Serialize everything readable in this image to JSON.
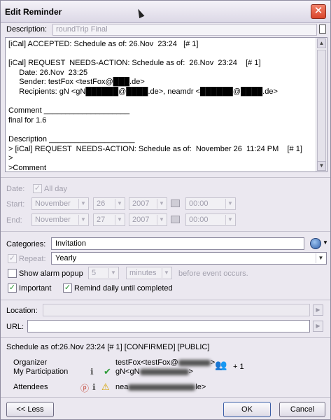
{
  "window": {
    "title": "Edit Reminder",
    "close_glyph": "✕"
  },
  "description": {
    "label": "Description:",
    "value": "roundTrip Final"
  },
  "body_text": "[iCal] ACCEPTED: Schedule as of: 26.Nov  23:24   [# 1]\n\n[iCal] REQUEST  NEEDS-ACTION: Schedule as of:  26.Nov  23:24    [# 1]\n     Date: 26.Nov  23:25\n     Sender: testFox <testFox@███.de>\n     Recipients: gN <gN██████@████.de>, neamdr <██████@████.de>\n\nComment ____________________\nfinal for 1.6\n\nDescription ____________________\n> [iCal] REQUEST  NEEDS-ACTION: Schedule as of:  November 26  11:24 PM    [# 1]\n>\n>Comment ____________________",
  "date": {
    "label": "Date:",
    "allday_label": "All day",
    "start_label": "Start:",
    "end_label": "End:",
    "start": {
      "month": "November",
      "day": "26",
      "year": "2007",
      "time": "00:00"
    },
    "end": {
      "month": "November",
      "day": "27",
      "year": "2007",
      "time": "00:00"
    }
  },
  "categories": {
    "label": "Categories:",
    "value": "Invitation"
  },
  "repeat": {
    "label": "Repeat:",
    "value": "Yearly"
  },
  "alarm": {
    "label": "Show alarm popup",
    "amount": "5",
    "unit": "minutes",
    "suffix": "before event occurs."
  },
  "important_label": "Important",
  "remind_label": "Remind daily until completed",
  "location": {
    "label": "Location:",
    "value": ""
  },
  "url": {
    "label": "URL:",
    "value": ""
  },
  "schedule": {
    "header": "Schedule  as of:26.Nov  23:24  [# 1] [CONFIRMED] [PUBLIC]",
    "organizer_label": "Organizer",
    "organizer_value": "testFox<testFox@",
    "organizer_suffix": ">",
    "participation_label": "My Participation",
    "participation_value": "gN<gN",
    "participation_suffix": ">",
    "plus_count": "+ 1",
    "attendees_label": "Attendees",
    "attendee_value": "nea",
    "attendee_suffix": "le>"
  },
  "buttons": {
    "less": "<< Less",
    "ok": "OK",
    "cancel": "Cancel"
  },
  "colors": {
    "accent": "#3a5da6",
    "check_green": "#1f8f2a",
    "close_red": "#d9442b"
  },
  "icons": [
    "close-icon",
    "document-icon",
    "calendar-icon",
    "globe-icon",
    "play-icon",
    "people-icon",
    "warning-icon",
    "check-icon"
  ]
}
